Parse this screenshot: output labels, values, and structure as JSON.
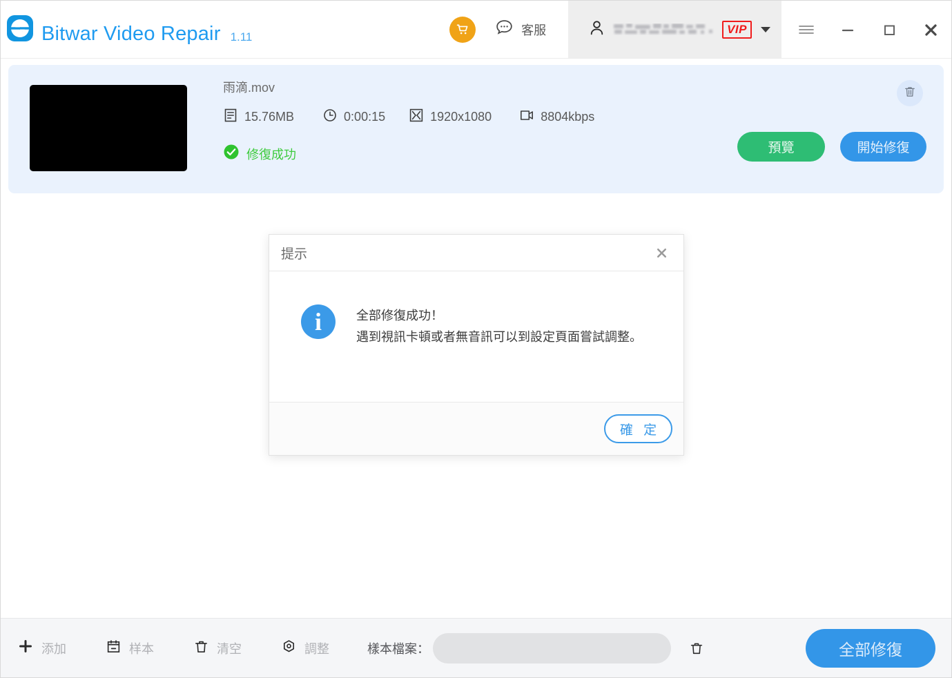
{
  "app": {
    "title": "Bitwar Video Repair",
    "version": "1.11",
    "logo_icon": "bitwar-logo-icon"
  },
  "header": {
    "cart_icon": "shopping-cart-icon",
    "support_icon": "chat-bubble-icon",
    "support_label": "客服",
    "user_icon": "person-icon",
    "user_name": "",
    "vip_badge": "VIP",
    "dropdown_icon": "chevron-down-icon",
    "menu_icon": "hamburger-menu-icon",
    "minimize_icon": "minimize-icon",
    "maximize_icon": "maximize-icon",
    "close_icon": "close-icon"
  },
  "file_card": {
    "thumbnail": "video-thumbnail",
    "name": "雨滴.mov",
    "meta": [
      {
        "icon": "file-size-icon",
        "value": "15.76MB"
      },
      {
        "icon": "clock-icon",
        "value": "0:00:15"
      },
      {
        "icon": "resolution-icon",
        "value": "1920x1080"
      },
      {
        "icon": "video-camera-icon",
        "value": "8804kbps"
      }
    ],
    "status_icon": "check-circle-icon",
    "status_text": "修復成功",
    "status_color": "#3ecb3e",
    "delete_icon": "trash-icon",
    "preview_label": "預覽",
    "preview_color": "#2ebd74",
    "start_repair_label": "開始修復",
    "start_repair_color": "#3396e8",
    "card_bg": "#eaf2fd"
  },
  "dialog": {
    "title": "提示",
    "close_icon": "close-icon",
    "info_icon": "info-circle-icon",
    "info_glyph": "i",
    "message_line1": "全部修復成功！",
    "message_line2": "遇到視訊卡頓或者無音訊可以到設定頁面嘗試調整。",
    "confirm_label": "確 定",
    "confirm_color": "#3b9ae8"
  },
  "footer": {
    "tools": [
      {
        "icon": "plus-icon",
        "label": "添加"
      },
      {
        "icon": "sample-calendar-icon",
        "label": "样本"
      },
      {
        "icon": "trash-icon",
        "label": "清空"
      },
      {
        "icon": "settings-gear-icon",
        "label": "調整"
      }
    ],
    "sample_file_label": "樣本檔案：",
    "sample_file_value": "",
    "sample_file_placeholder": "",
    "clear_sample_icon": "trash-icon",
    "repair_all_label": "全部修復",
    "repair_all_color": "#3396e8"
  }
}
